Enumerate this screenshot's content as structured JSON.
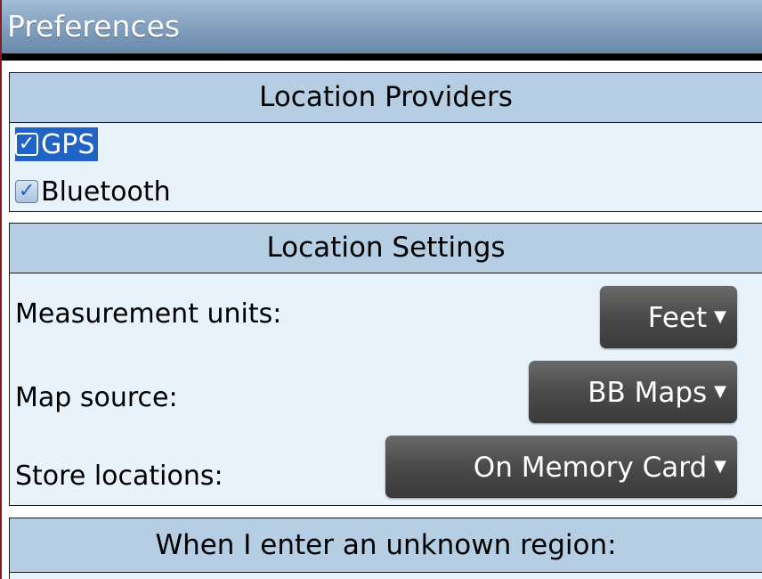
{
  "title": "Preferences",
  "location_providers": {
    "header": "Location Providers",
    "items": [
      {
        "label": "GPS",
        "checked": true,
        "selected": true
      },
      {
        "label": "Bluetooth",
        "checked": true,
        "selected": false
      }
    ]
  },
  "location_settings": {
    "header": "Location Settings",
    "rows": [
      {
        "label": "Measurement units:",
        "value": "Feet"
      },
      {
        "label": "Map source:",
        "value": "BB Maps"
      },
      {
        "label": "Store locations:",
        "value": "On Memory Card"
      }
    ]
  },
  "unknown_region": {
    "header": "When I enter an unknown region:"
  },
  "icons": {
    "checkmark": "✓",
    "dropdown_arrow": "▼"
  },
  "colors": {
    "title_bar": "#7f9dbd",
    "section_header": "#b5cee4",
    "section_bg": "#e8f2fb",
    "selection": "#1f63c4",
    "dropdown": "#4a4a4a"
  }
}
